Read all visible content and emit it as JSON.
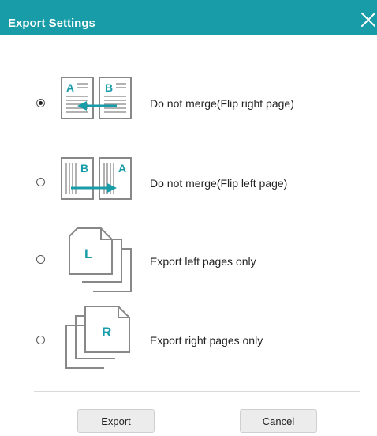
{
  "dialog": {
    "title": "Export Settings",
    "close_icon": "close-icon",
    "accent_color": "#189ca8"
  },
  "options": [
    {
      "label": "Do not merge(Flip right page)",
      "selected": true,
      "icon": "flip-right-page-icon"
    },
    {
      "label": "Do not merge(Flip left page)",
      "selected": false,
      "icon": "flip-left-page-icon"
    },
    {
      "label": "Export left pages only",
      "selected": false,
      "icon": "left-pages-icon"
    },
    {
      "label": "Export right pages only",
      "selected": false,
      "icon": "right-pages-icon"
    }
  ],
  "buttons": {
    "export_label": "Export",
    "cancel_label": "Cancel"
  }
}
